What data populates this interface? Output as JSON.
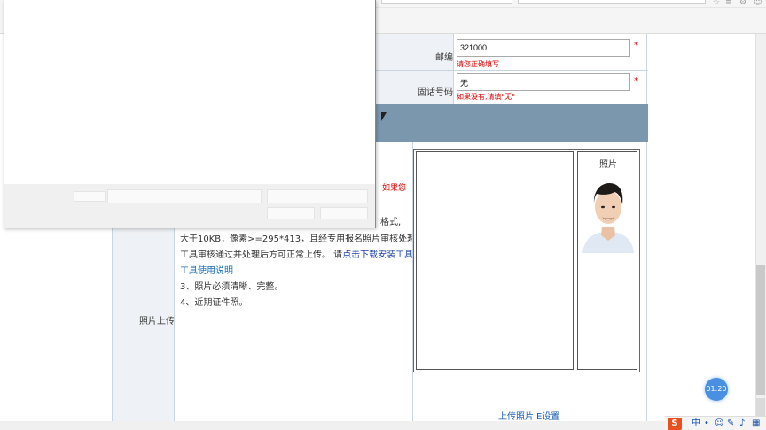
{
  "form": {
    "postcode": {
      "label": "邮编",
      "value": "321000",
      "required_mark": "*",
      "hint": "请您正确填写"
    },
    "phone": {
      "label": "固话号码",
      "value": "无",
      "required_mark": "*",
      "hint": "如果没有,请填\"无\""
    },
    "photo": {
      "label": "照片上传",
      "rule_partial_top": "格式,",
      "rule_red_partial": "如果您",
      "rule_line1": "大于10KB，像素>=295*413，且经专用报名照片审核处理",
      "rule_line2_prefix": "工具审核通过并处理后方可正常上传。 请",
      "rule_line2_link": "点击下载安装工具",
      "rule_line3_link": "工具使用说明",
      "rule_3": "3、照片必须清晰、完整。",
      "rule_4": "4、近期证件照。",
      "preview_title": "照片",
      "upload_link": "上传照片IE设置"
    }
  },
  "timer": "01:20",
  "tray": {
    "ime_logo": "S",
    "ime_lang": "中",
    "icons": [
      "dot-icon",
      "emoji-icon",
      "pen-icon",
      "mic-icon",
      "keyboard-icon"
    ]
  },
  "colors": {
    "banner": "#7b97ae",
    "label_bg": "#eef1f5",
    "required": "#dd0000",
    "link": "#1a3ea6",
    "timer": "#4a90e2"
  }
}
